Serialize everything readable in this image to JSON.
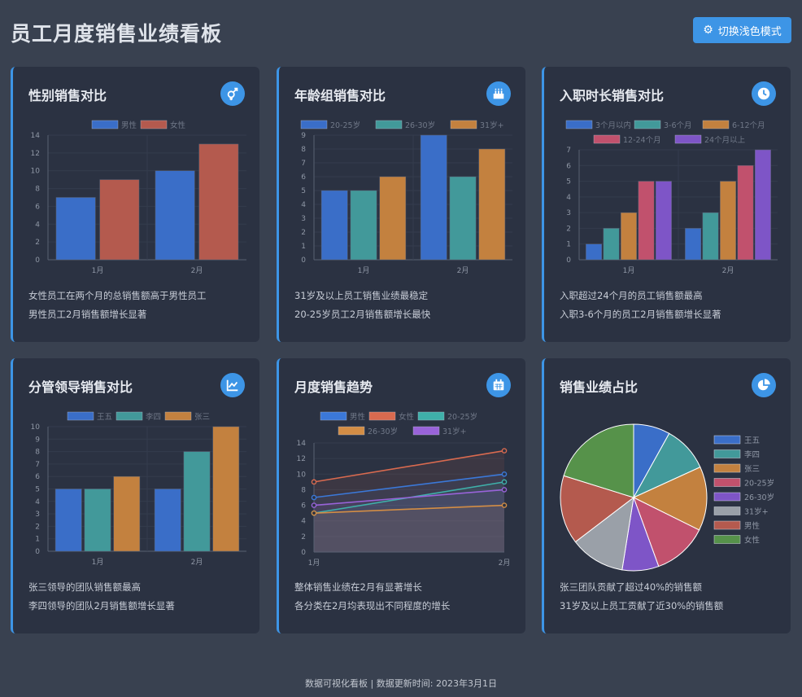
{
  "page": {
    "title": "员工月度销售业绩看板",
    "toggle_label": "切换浅色模式",
    "footer": "数据可视化看板 | 数据更新时间: 2023年3月1日"
  },
  "cards": [
    {
      "title": "性别销售对比",
      "icon": "gender-icon",
      "notes": [
        "女性员工在两个月的总销售额高于男性员工",
        "男性员工2月销售额增长显著"
      ],
      "chart_data": {
        "type": "bar",
        "categories": [
          "1月",
          "2月"
        ],
        "series": [
          {
            "name": "男性",
            "values": [
              7,
              10
            ],
            "color": "#3a6ec8"
          },
          {
            "name": "女性",
            "values": [
              9,
              13
            ],
            "color": "#b45a4e"
          }
        ],
        "ylim": [
          0,
          14
        ],
        "ystep": 2,
        "legend": "top"
      }
    },
    {
      "title": "年龄组销售对比",
      "icon": "birthday-cake-icon",
      "notes": [
        "31岁及以上员工销售业绩最稳定",
        "20-25岁员工2月销售额增长最快"
      ],
      "chart_data": {
        "type": "bar",
        "categories": [
          "1月",
          "2月"
        ],
        "series": [
          {
            "name": "20-25岁",
            "values": [
              5,
              9
            ],
            "color": "#3a6ec8"
          },
          {
            "name": "26-30岁",
            "values": [
              5,
              6
            ],
            "color": "#42999a"
          },
          {
            "name": "31岁+",
            "values": [
              6,
              8
            ],
            "color": "#c3813f"
          }
        ],
        "ylim": [
          0,
          9
        ],
        "ystep": 1,
        "legend": "top"
      }
    },
    {
      "title": "入职时长销售对比",
      "icon": "clock-icon",
      "notes": [
        "入职超过24个月的员工销售额最高",
        "入职3-6个月的员工2月销售额增长显著"
      ],
      "chart_data": {
        "type": "bar",
        "categories": [
          "1月",
          "2月"
        ],
        "series": [
          {
            "name": "3个月以内",
            "values": [
              1,
              2
            ],
            "color": "#3a6ec8"
          },
          {
            "name": "3-6个月",
            "values": [
              2,
              3
            ],
            "color": "#42999a"
          },
          {
            "name": "6-12个月",
            "values": [
              3,
              5
            ],
            "color": "#c3813f"
          },
          {
            "name": "12-24个月",
            "values": [
              5,
              6
            ],
            "color": "#c1516d"
          },
          {
            "name": "24个月以上",
            "values": [
              5,
              7
            ],
            "color": "#7e55c7"
          }
        ],
        "ylim": [
          0,
          7
        ],
        "ystep": 1,
        "legend": "top"
      }
    },
    {
      "title": "分管领导销售对比",
      "icon": "chart-line-icon",
      "notes": [
        "张三领导的团队销售额最高",
        "李四领导的团队2月销售额增长显著"
      ],
      "chart_data": {
        "type": "bar",
        "categories": [
          "1月",
          "2月"
        ],
        "series": [
          {
            "name": "王五",
            "values": [
              5,
              5
            ],
            "color": "#3a6ec8"
          },
          {
            "name": "李四",
            "values": [
              5,
              8
            ],
            "color": "#42999a"
          },
          {
            "name": "张三",
            "values": [
              6,
              10
            ],
            "color": "#c3813f"
          }
        ],
        "ylim": [
          0,
          10
        ],
        "ystep": 1,
        "legend": "top"
      }
    },
    {
      "title": "月度销售趋势",
      "icon": "calendar-icon",
      "notes": [
        "整体销售业绩在2月有显著增长",
        "各分类在2月均表现出不同程度的增长"
      ],
      "chart_data": {
        "type": "line",
        "x": [
          "1月",
          "2月"
        ],
        "series": [
          {
            "name": "男性",
            "values": [
              7,
              10
            ],
            "color": "#3b78d8"
          },
          {
            "name": "女性",
            "values": [
              9,
              13
            ],
            "color": "#d96a4f"
          },
          {
            "name": "20-25岁",
            "values": [
              5,
              9
            ],
            "color": "#3fb0aa"
          },
          {
            "name": "26-30岁",
            "values": [
              5,
              6
            ],
            "color": "#d38d45"
          },
          {
            "name": "31岁+",
            "values": [
              6,
              8
            ],
            "color": "#9963d9"
          }
        ],
        "ylim": [
          0,
          14
        ],
        "ystep": 2,
        "legend": "top"
      }
    },
    {
      "title": "销售业绩占比",
      "icon": "pie-chart-icon",
      "notes": [
        "张三团队贡献了超过40%的销售额",
        "31岁及以上员工贡献了近30%的销售额"
      ],
      "chart_data": {
        "type": "pie",
        "labels": [
          "王五",
          "李四",
          "张三",
          "20-25岁",
          "26-30岁",
          "31岁+",
          "男性",
          "女性"
        ],
        "values": [
          8,
          10,
          14,
          12,
          8,
          12,
          15,
          20
        ],
        "colors": [
          "#3a6ec8",
          "#42999a",
          "#c3813f",
          "#c1516d",
          "#7e55c7",
          "#9aa0a8",
          "#b45a4e",
          "#56924a"
        ],
        "legend": "right"
      }
    }
  ]
}
